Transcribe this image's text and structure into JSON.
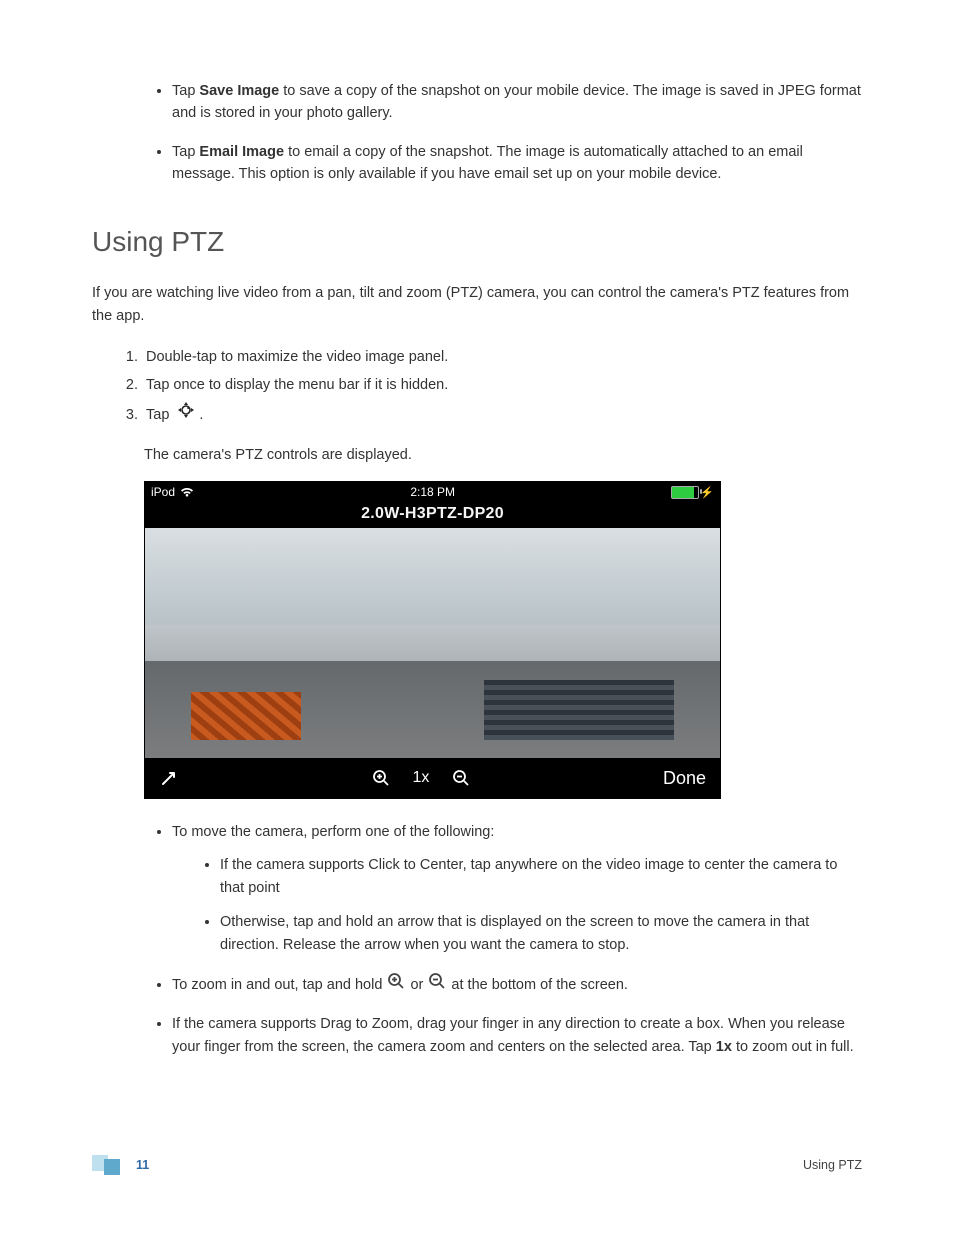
{
  "top_list": [
    {
      "lead": "Tap ",
      "bold": "Save Image",
      "rest": " to save a copy of the snapshot on your mobile device. The image is saved in JPEG format and is stored in your photo gallery."
    },
    {
      "lead": "Tap ",
      "bold": "Email Image",
      "rest": " to email a copy of the snapshot. The image is automatically attached to an email message. This option is only available if you have email set up on your mobile device."
    }
  ],
  "heading": "Using PTZ",
  "intro": "If you are watching live video from a pan, tilt and zoom (PTZ) camera, you can control the camera's PTZ features from the app.",
  "steps": {
    "s1": "Double-tap to maximize the video image panel.",
    "s2": "Tap once to display the menu bar if it is hidden.",
    "s3_lead": "Tap ",
    "s3_tail": "."
  },
  "after_steps": "The camera's PTZ controls are displayed.",
  "screenshot": {
    "status_device": "iPod",
    "status_time": "2:18 PM",
    "camera_title": "2.0W-H3PTZ-DP20",
    "zoom_label": "1x",
    "done_label": "Done"
  },
  "move_intro": "To move the camera, perform one of the following:",
  "move_sub1": "If the camera supports Click to Center, tap anywhere on the video image to center the camera to that point",
  "move_sub2": "Otherwise, tap and hold an arrow that is displayed on the screen to move the camera in that direction. Release the arrow when you want the camera to stop.",
  "zoom_line_a": "To zoom in and out, tap and hold ",
  "zoom_line_mid": " or ",
  "zoom_line_b": " at the bottom of the screen.",
  "drag_a": "If the camera supports Drag to Zoom, drag your finger in any direction to create a box. When you release your finger from the screen, the camera zoom and centers on the selected area. Tap ",
  "drag_bold": "1x",
  "drag_b": " to zoom out in full.",
  "footer": {
    "page": "11",
    "section": "Using PTZ"
  }
}
